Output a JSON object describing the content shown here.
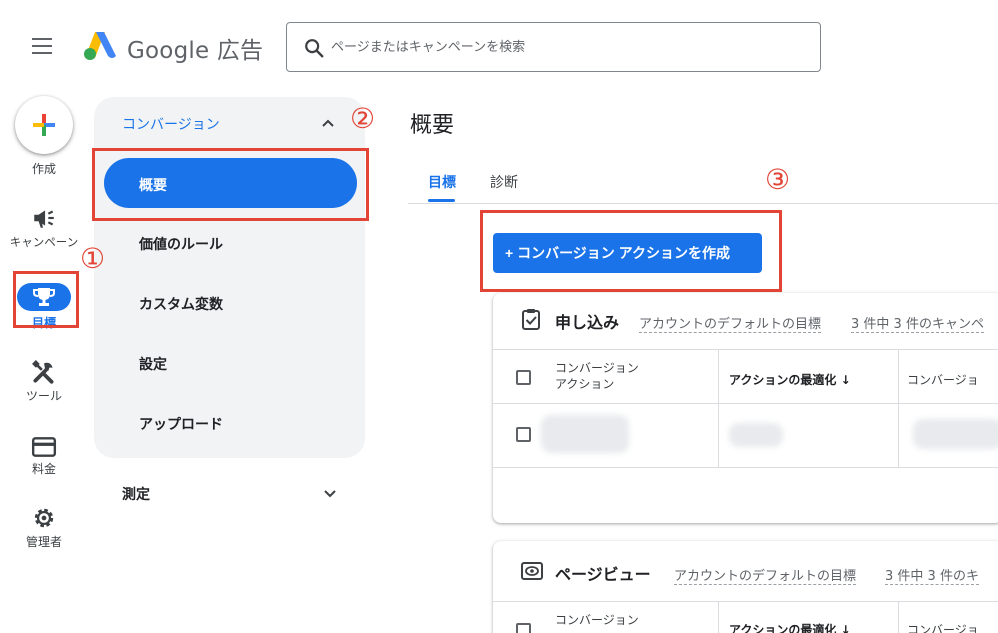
{
  "header": {
    "logo_text": "Google 広告",
    "search_placeholder": "ページまたはキャンペーンを検索"
  },
  "rail": {
    "create": "作成",
    "campaigns": "キャンペーン",
    "goals": "目標",
    "tools": "ツール",
    "billing": "料金",
    "admin": "管理者"
  },
  "submenu": {
    "header": "コンバージョン",
    "items": [
      "概要",
      "価値のルール",
      "カスタム変数",
      "設定",
      "アップロード"
    ],
    "measurement": "測定"
  },
  "annotations": {
    "one": "①",
    "two": "②",
    "three": "③"
  },
  "main": {
    "title": "概要",
    "tabs": [
      "目標",
      "診断"
    ],
    "create_button": "+ コンバージョン アクションを作成",
    "cards": [
      {
        "title": "申し込み",
        "default_goal": "アカウントのデフォルトの目標",
        "campaign_count": "3 件中 3 件のキャンペ",
        "col_action": "コンバージョン\nアクション",
        "col_optimization": "アクションの最適化 ↓",
        "col_conversion": "コンバージョ"
      },
      {
        "title": "ページビュー",
        "default_goal": "アカウントのデフォルトの目標",
        "campaign_count": "3 件中 3 件のキ",
        "col_action": "コンバージョン",
        "col_optimization": "アクションの最適化 ↓",
        "col_conversion": "コンバージョ"
      }
    ]
  },
  "colors": {
    "accent": "#1a73e8",
    "annotation": "#e24436",
    "submenu_bg": "#f1f3f4"
  }
}
